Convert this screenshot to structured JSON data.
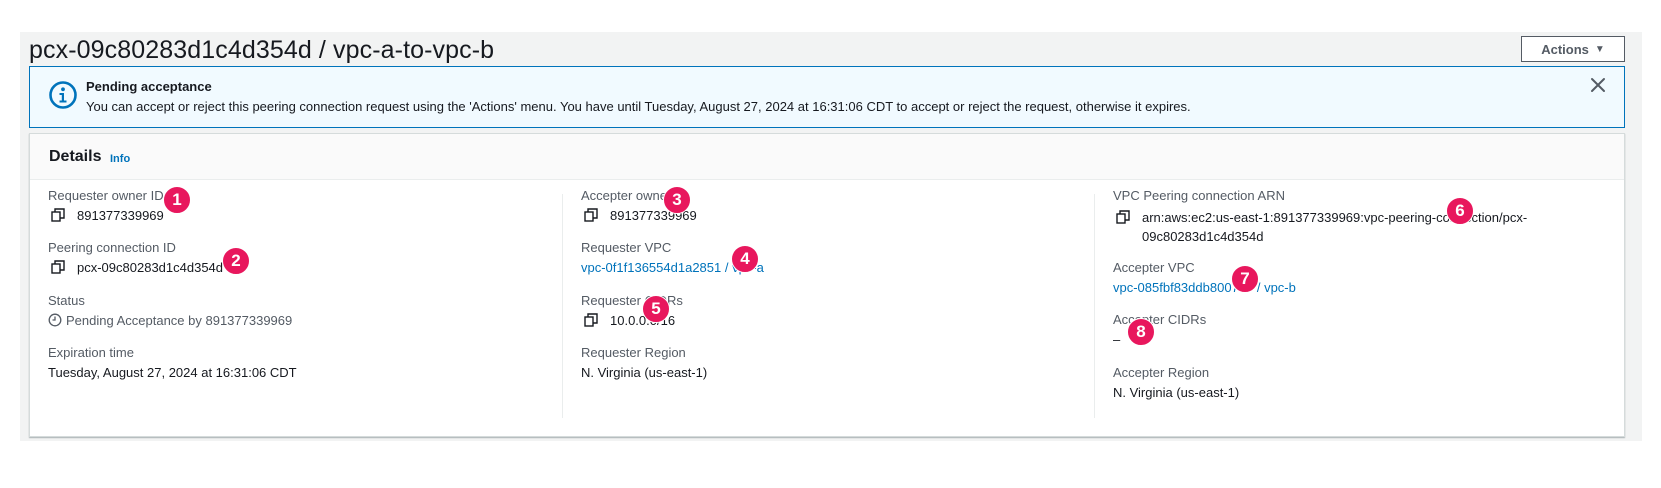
{
  "header": {
    "title": "pcx-09c80283d1c4d354d / vpc-a-to-vpc-b",
    "actions_label": "Actions"
  },
  "alert": {
    "title": "Pending acceptance",
    "body": "You can accept or reject this peering connection request using the 'Actions' menu. You have until Tuesday, August 27, 2024 at 16:31:06 CDT to accept or reject the request, otherwise it expires."
  },
  "details": {
    "heading": "Details",
    "info_link": "Info",
    "requester_owner_id": {
      "label": "Requester owner ID",
      "value": "891377339969"
    },
    "peering_connection_id": {
      "label": "Peering connection ID",
      "value": "pcx-09c80283d1c4d354d"
    },
    "status": {
      "label": "Status",
      "value": "Pending Acceptance by 891377339969"
    },
    "expiration_time": {
      "label": "Expiration time",
      "value": "Tuesday, August 27, 2024 at 16:31:06 CDT"
    },
    "accepter_owner_id": {
      "label": "Accepter owner ID",
      "value": "891377339969"
    },
    "requester_vpc": {
      "label": "Requester VPC",
      "value": "vpc-0f1f136554d1a2851 / vpc-a"
    },
    "requester_cidrs": {
      "label": "Requester CIDRs",
      "value": "10.0.0.0/16"
    },
    "requester_region": {
      "label": "Requester Region",
      "value": "N. Virginia (us-east-1)"
    },
    "peering_arn": {
      "label": "VPC Peering connection ARN",
      "value": "arn:aws:ec2:us-east-1:891377339969:vpc-peering-connection/pcx-09c80283d1c4d354d"
    },
    "accepter_vpc": {
      "label": "Accepter VPC",
      "value": "vpc-085fbf83ddb800707 / vpc-b"
    },
    "accepter_cidrs": {
      "label": "Accepter CIDRs",
      "value": "–"
    },
    "accepter_region": {
      "label": "Accepter Region",
      "value": "N. Virginia (us-east-1)"
    }
  },
  "callouts": [
    "1",
    "2",
    "3",
    "4",
    "5",
    "6",
    "7",
    "8"
  ],
  "colors": {
    "link": "#0073bb",
    "alert_border": "#0073bb",
    "alert_bg": "#f1faff",
    "callout": "#e8175d"
  }
}
